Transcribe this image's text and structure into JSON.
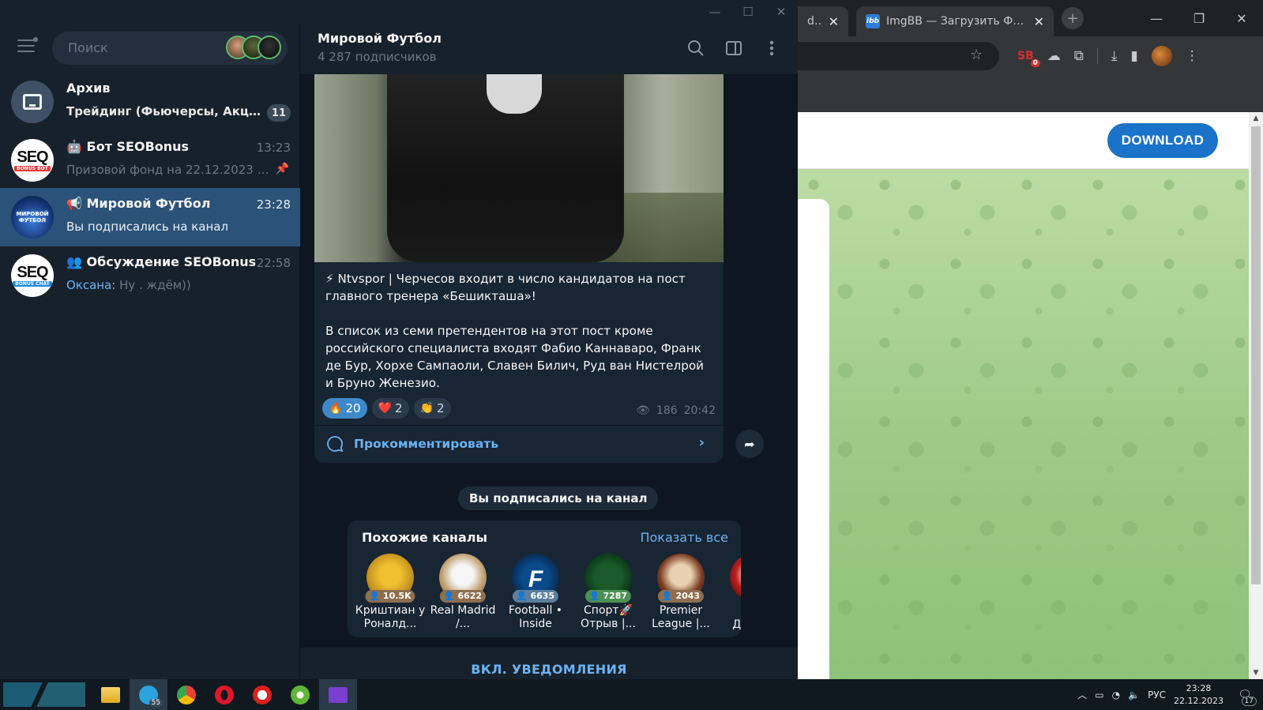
{
  "browser": {
    "tabs": [
      {
        "title": "dfoo",
        "close": "✕"
      },
      {
        "title": "ImgBB — Загрузить Фото -",
        "close": "✕"
      }
    ],
    "extension_badge": "0",
    "download_label": "DOWNLOAD"
  },
  "telegram": {
    "search_placeholder": "Поиск",
    "chats": [
      {
        "name": "Архив",
        "message": "Трейдинг (Фьючерсы, Акции...",
        "badge": "11"
      },
      {
        "name": "Бот SEOBonus",
        "time": "13:23",
        "message": "Призовой фонд на 22.12.2023 с..."
      },
      {
        "name": "Мировой Футбол",
        "time": "23:28",
        "message": "Вы подписались на канал"
      },
      {
        "name": "Обсуждение SEOBonus",
        "time": "22:58",
        "sender": "Оксана:",
        "message": "Ну . ждём))"
      }
    ],
    "header": {
      "title": "Мировой Футбол",
      "subtitle": "4 287 подписчиков"
    },
    "post": {
      "paragraph1": "⚡ Ntvspor | Черчесов входит в число кандидатов на пост главного тренера «Бешикташа»!",
      "paragraph2": "В список из семи претендентов на этот пост кроме российского специалиста входят Фабио Каннаваро, Франк де Бур, Хорхе Сампаоли, Славен Билич, Руд ван Нистелрой и Бруно Женезио.",
      "reactions": [
        {
          "emoji": "🔥",
          "count": "20"
        },
        {
          "emoji": "❤️",
          "count": "2"
        },
        {
          "emoji": "👏",
          "count": "2"
        }
      ],
      "views": "186",
      "time": "20:42",
      "comment_label": "Прокомментировать"
    },
    "service_message": "Вы подписались на канал",
    "similar": {
      "title": "Похожие каналы",
      "show_all": "Показать все",
      "channels": [
        {
          "count": "10.5K",
          "name": "Криштиан у Роналд..."
        },
        {
          "count": "6622",
          "name": "Real Madrid /..."
        },
        {
          "count": "6635",
          "name": "Football • Inside"
        },
        {
          "count": "7287",
          "name": "Спорт🚀 Отрыв |..."
        },
        {
          "count": "2043",
          "name": "Premier League |..."
        },
        {
          "count": "",
          "name": "Дне Фу"
        }
      ]
    },
    "notify_label": "ВКЛ. УВЕДОМЛЕНИЯ"
  },
  "taskbar": {
    "telegram_count": "55",
    "language": "РУС",
    "time": "23:28",
    "date": "22.12.2023",
    "notifications": "17"
  }
}
